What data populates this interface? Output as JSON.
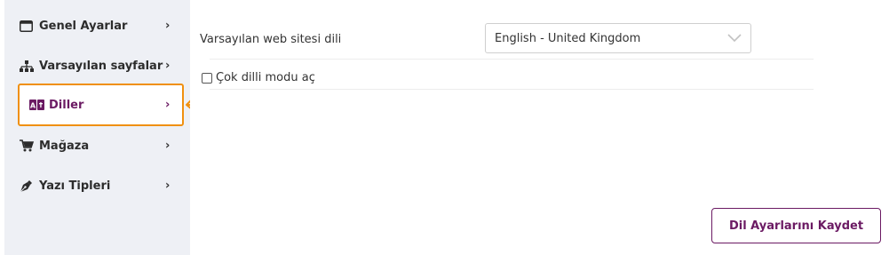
{
  "sidebar": {
    "items": [
      {
        "label": "Genel Ayarlar",
        "icon": "window-icon",
        "active": false
      },
      {
        "label": "Varsayılan sayfalar",
        "icon": "sitemap-icon",
        "active": false
      },
      {
        "label": "Diller",
        "icon": "language-icon",
        "active": true
      },
      {
        "label": "Mağaza",
        "icon": "cart-icon",
        "active": false
      },
      {
        "label": "Yazı Tipleri",
        "icon": "pen-nib-icon",
        "active": false
      }
    ],
    "chevron": "›"
  },
  "main": {
    "default_language_label": "Varsayılan web sitesi dili",
    "default_language_value": "English - United Kingdom",
    "multilang_label": "Çok dilli modu aç",
    "multilang_checked": false,
    "save_button": "Dil Ayarlarını Kaydet"
  },
  "colors": {
    "accent": "#6b1a63",
    "highlight": "#f0900f",
    "sidebar_bg": "#eef0f5"
  }
}
